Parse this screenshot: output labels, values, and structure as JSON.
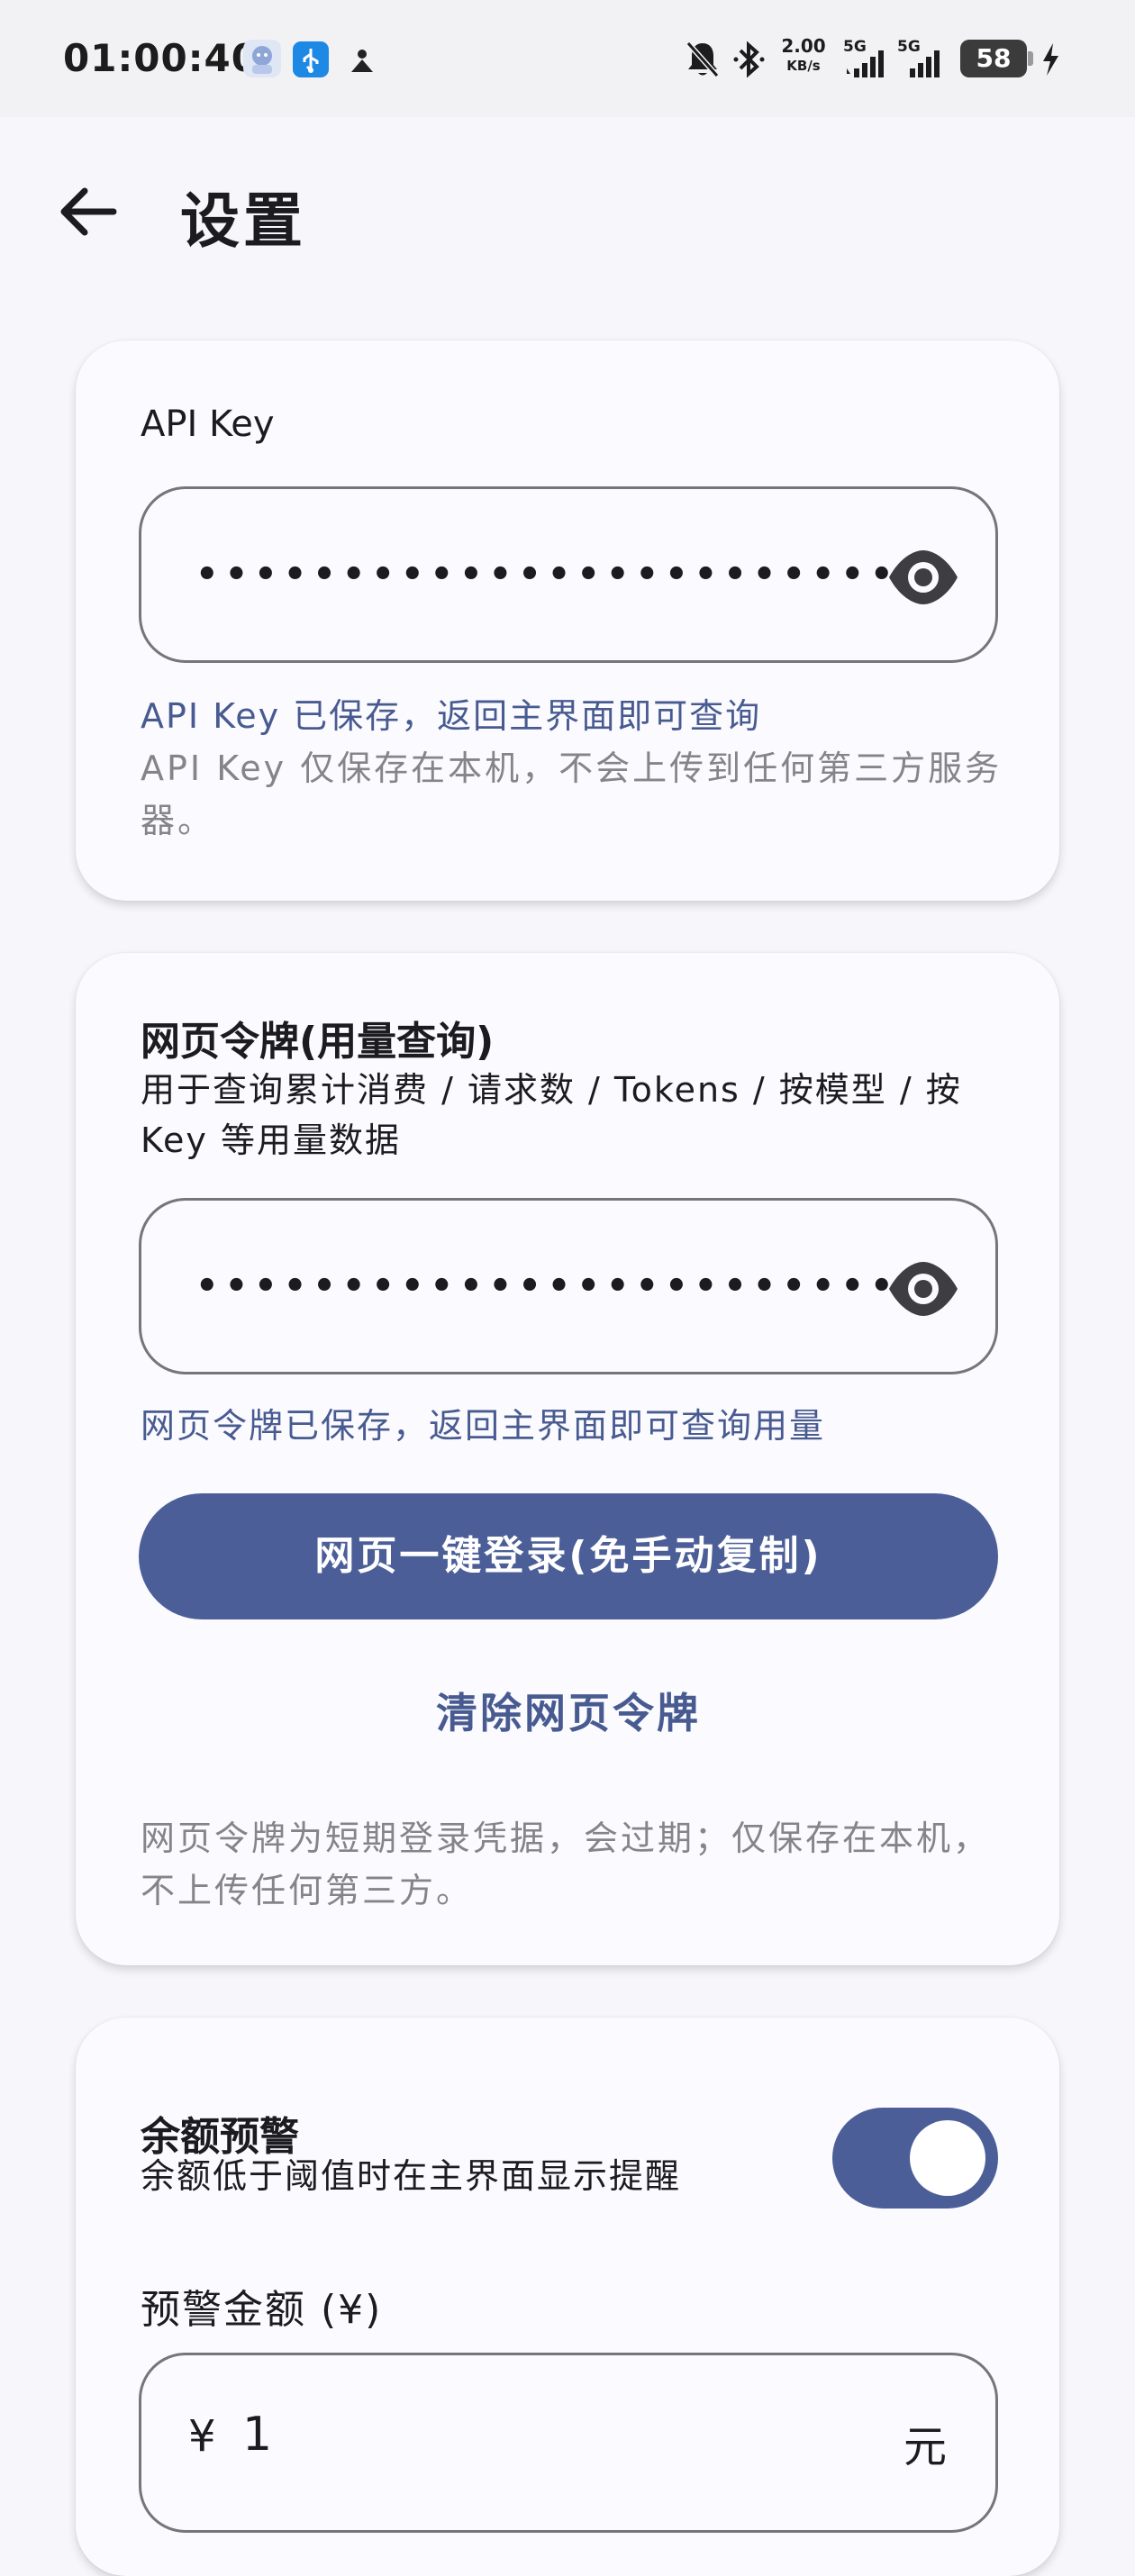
{
  "status_bar": {
    "time": "01:00:40",
    "net_speed_value": "2.00",
    "net_speed_unit": "KB/s",
    "sim1": "5G",
    "sim2": "5G",
    "battery": "58"
  },
  "app_bar": {
    "title": "设置"
  },
  "api_key_card": {
    "label": "API Key",
    "value_masked": "••••••••••••••••••••••••",
    "saved_message": "API Key 已保存，返回主界面即可查询",
    "privacy_note": "API Key 仅保存在本机，不会上传到任何第三方服务器。"
  },
  "web_token_card": {
    "title": "网页令牌(用量查询)",
    "description": "用于查询累计消费 / 请求数 / Tokens / 按模型 / 按 Key 等用量数据",
    "value_masked": "••••••••••••••••••••••••",
    "saved_message": "网页令牌已保存，返回主界面即可查询用量",
    "login_button": "网页一键登录(免手动复制)",
    "clear_button": "清除网页令牌",
    "note": "网页令牌为短期登录凭据，会过期；仅保存在本机，不上传任何第三方。"
  },
  "balance_alert_card": {
    "title": "余额预警",
    "description": "余额低于阈值时在主界面显示提醒",
    "enabled": true,
    "amount_label": "预警金额 (¥)",
    "currency_prefix": "¥",
    "amount_value": "1",
    "unit": "元"
  },
  "colors": {
    "accent": "#4b5e98",
    "accent_text": "#485b91",
    "background": "#f7f6fb",
    "card": "#fbfafe"
  }
}
